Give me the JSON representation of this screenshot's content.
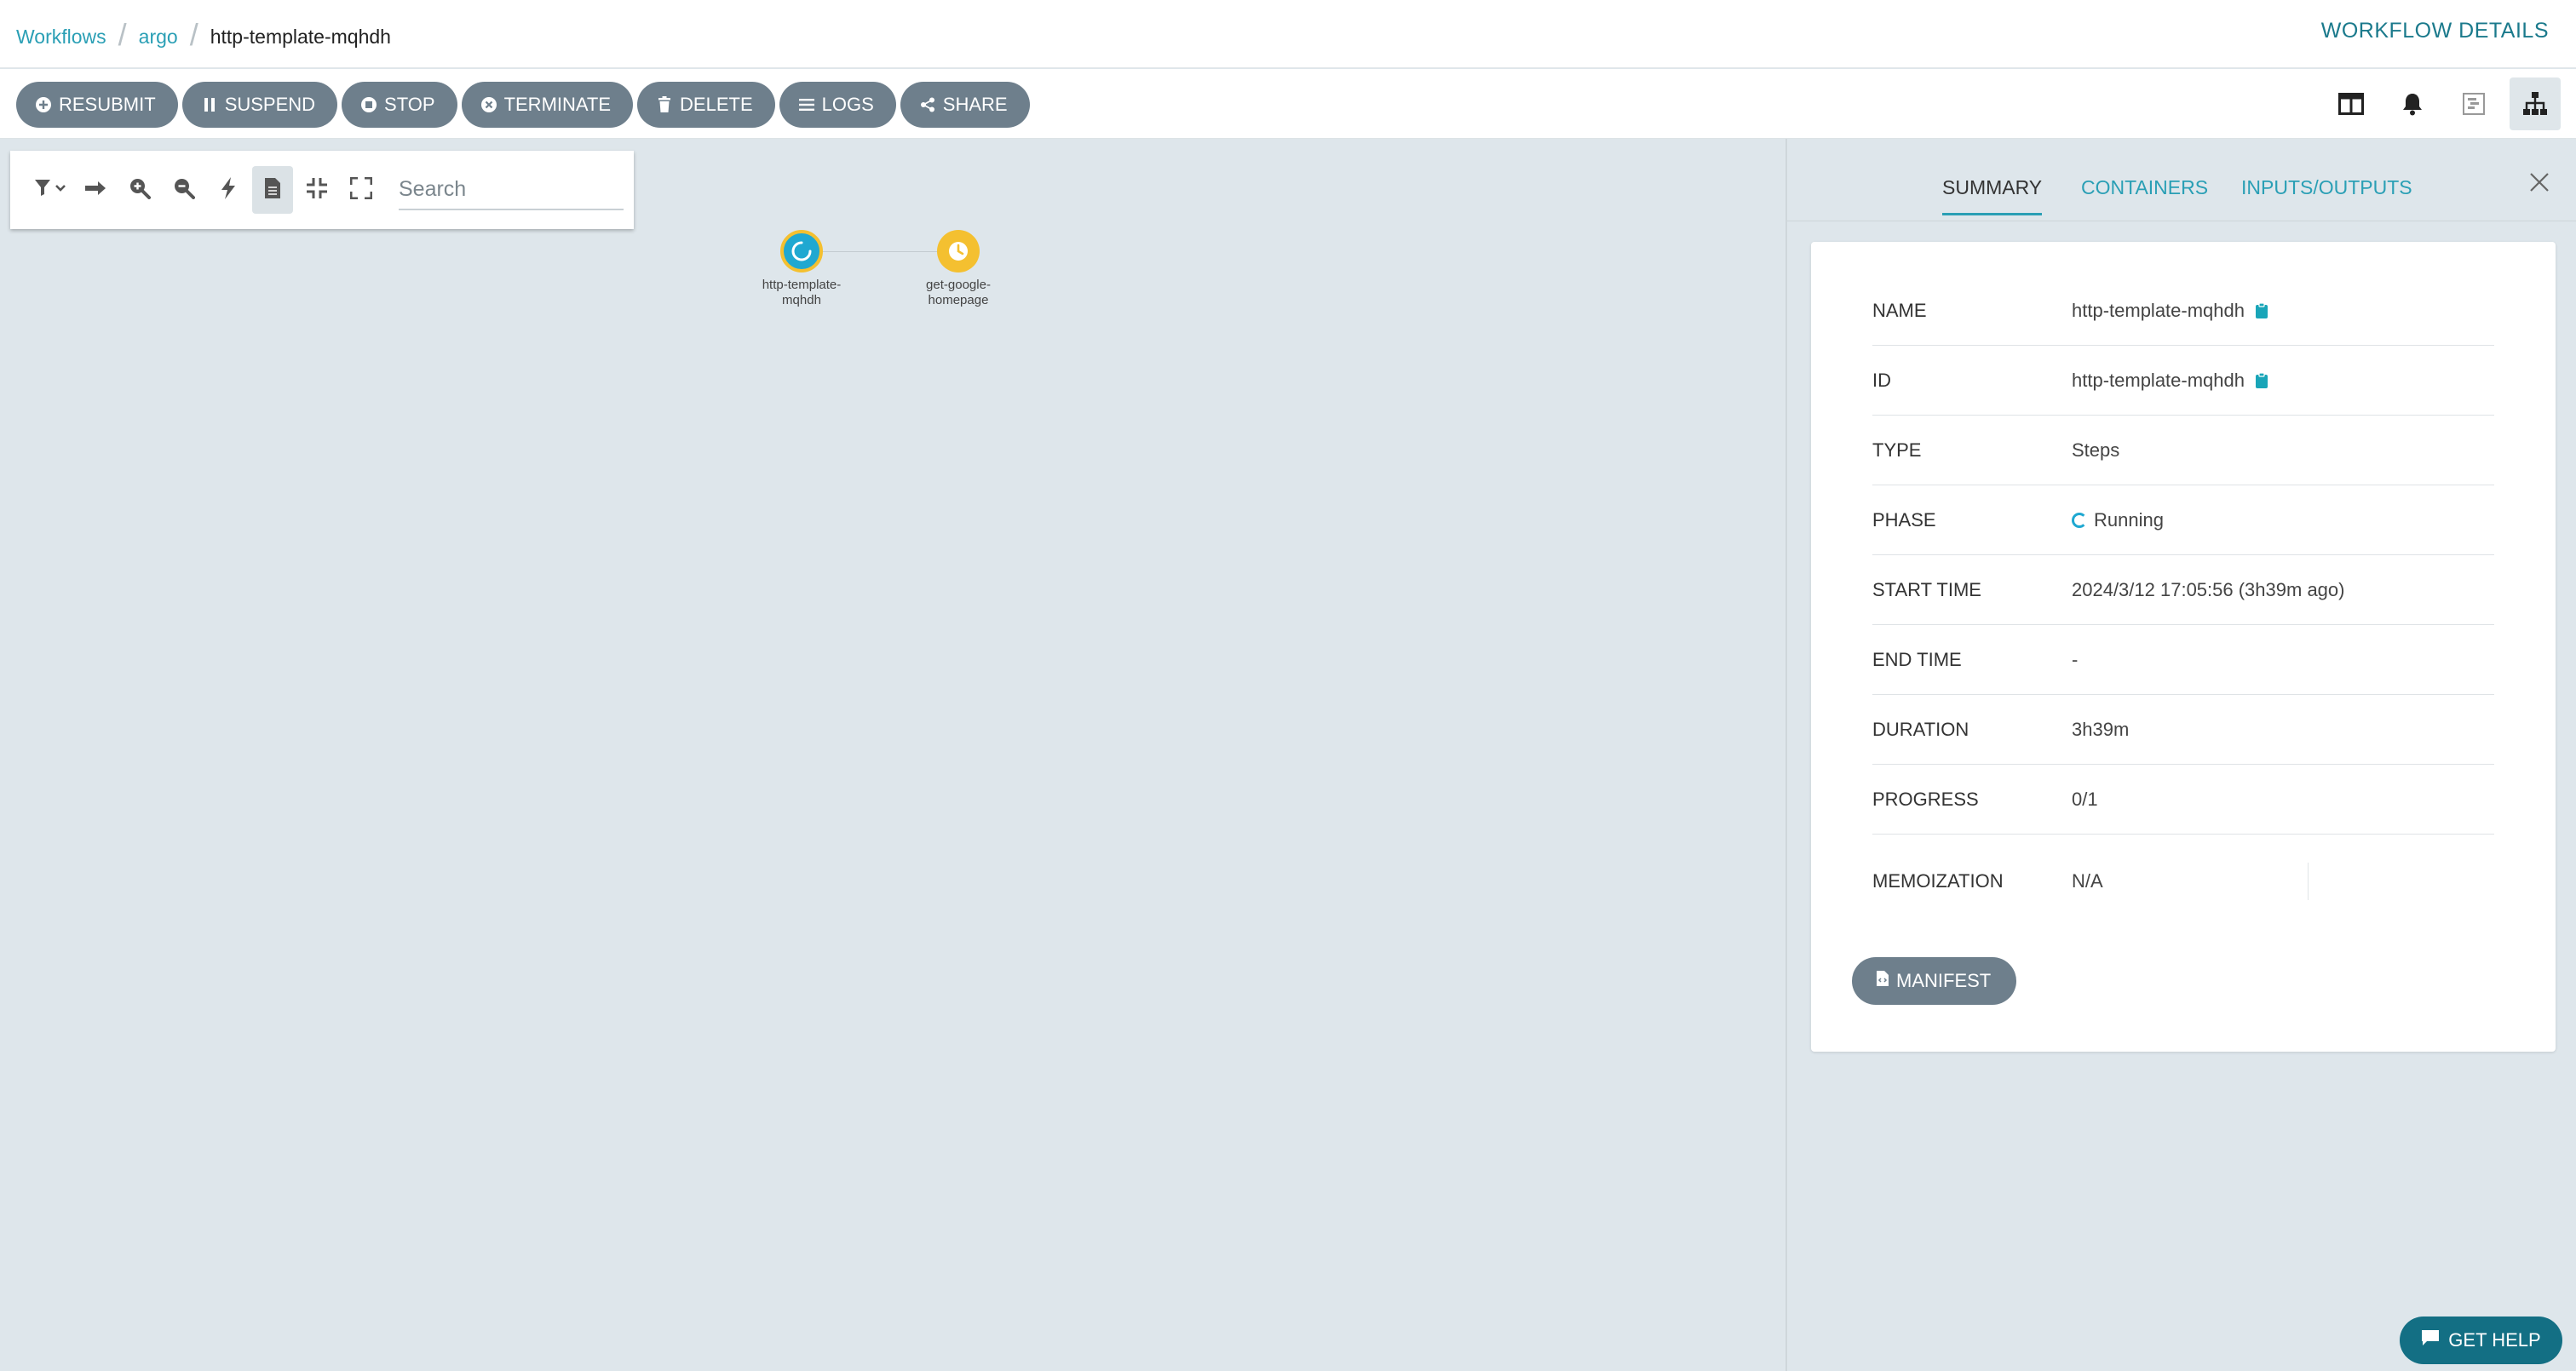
{
  "breadcrumb": {
    "items": [
      {
        "label": "Workflows"
      },
      {
        "label": "argo"
      },
      {
        "label": "http-template-mqhdh"
      }
    ]
  },
  "page_heading": "WORKFLOW DETAILS",
  "actions": {
    "resubmit": "RESUBMIT",
    "suspend": "SUSPEND",
    "stop": "STOP",
    "terminate": "TERMINATE",
    "delete": "DELETE",
    "logs": "LOGS",
    "share": "SHARE"
  },
  "view_icons": [
    "split-panel-icon",
    "bell-icon",
    "timeline-icon",
    "workflow-tree-icon"
  ],
  "graph_toolbar": {
    "search_placeholder": "Search"
  },
  "graph": {
    "nodes": [
      {
        "id": "http-template-mqhdh",
        "label_line1": "http-template-",
        "label_line2": "mqhdh",
        "phase": "Running",
        "color": "#1fa8d1"
      },
      {
        "id": "get-google-homepage",
        "label_line1": "get-google-",
        "label_line2": "homepage",
        "phase": "Pending",
        "color": "#f4c030"
      }
    ]
  },
  "panel": {
    "tabs": {
      "summary": "SUMMARY",
      "containers": "CONTAINERS",
      "inputs_outputs": "INPUTS/OUTPUTS"
    },
    "summary": {
      "name_key": "NAME",
      "name_value": "http-template-mqhdh",
      "id_key": "ID",
      "id_value": "http-template-mqhdh",
      "type_key": "TYPE",
      "type_value": "Steps",
      "phase_key": "PHASE",
      "phase_value": "Running",
      "start_key": "START TIME",
      "start_value": "2024/3/12 17:05:56 (3h39m ago)",
      "end_key": "END TIME",
      "end_value": "-",
      "duration_key": "DURATION",
      "duration_value": "3h39m",
      "progress_key": "PROGRESS",
      "progress_value": "0/1",
      "memo_key": "MEMOIZATION",
      "memo_value": "N/A"
    },
    "manifest_label": "MANIFEST"
  },
  "help_label": "GET HELP",
  "colors": {
    "accent": "#2a9fb5",
    "button": "#6e7f8c",
    "running": "#1fa8d1",
    "pending": "#f4c030",
    "help": "#136f84"
  }
}
